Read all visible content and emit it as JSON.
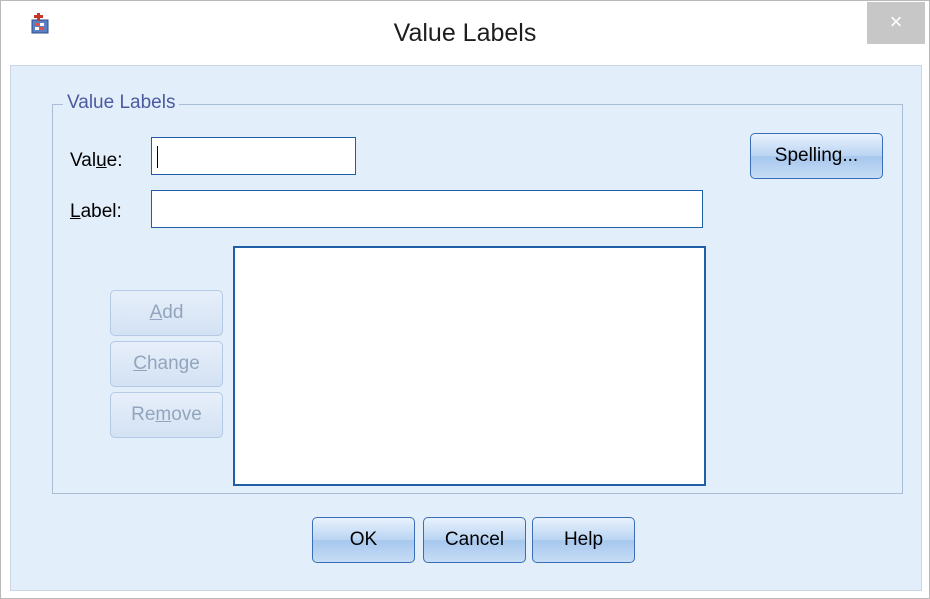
{
  "window": {
    "title": "Value Labels",
    "close_glyph": "×",
    "app_icon": "spss-data-icon"
  },
  "group": {
    "legend": "Value Labels"
  },
  "fields": {
    "value_label": "Value:",
    "value_input": "",
    "label_label": "Label:",
    "label_input": ""
  },
  "buttons": {
    "spelling": "Spelling...",
    "add": "Add",
    "change": "Change",
    "remove": "Remove",
    "ok": "OK",
    "cancel": "Cancel",
    "help": "Help"
  },
  "list": {
    "items": []
  },
  "colors": {
    "dialog_bg": "#e3eefb",
    "input_border": "#1f5fa8",
    "legend_text": "#4c5aa0",
    "disabled_text": "#93a5bd"
  }
}
